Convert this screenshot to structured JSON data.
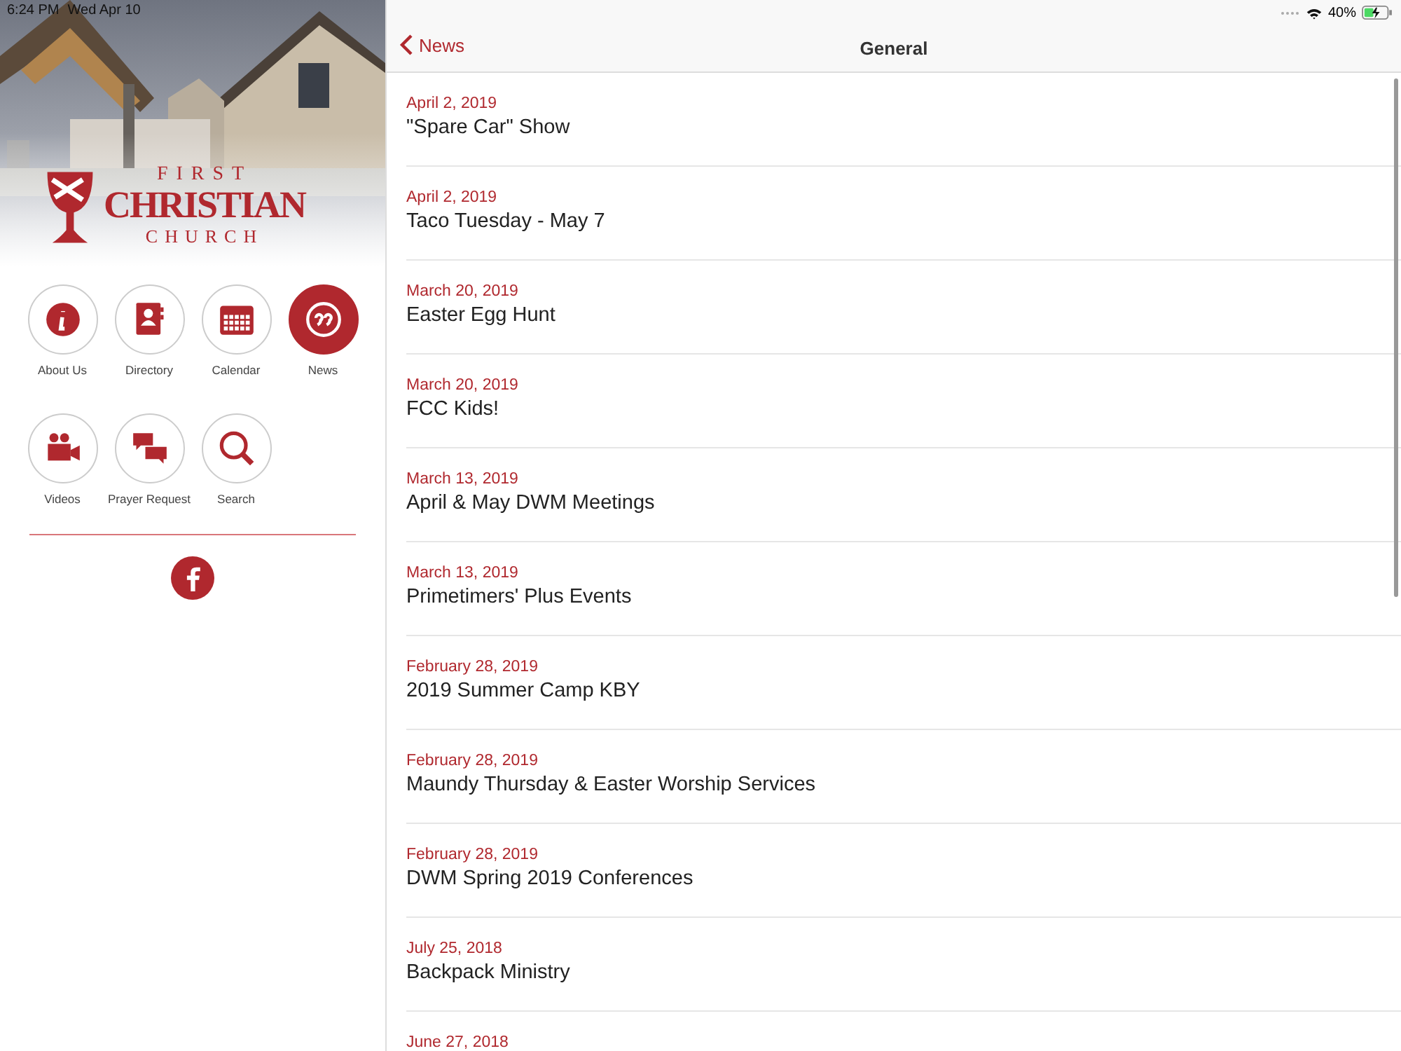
{
  "status_bar": {
    "time": "6:24 PM",
    "date": "Wed Apr 10",
    "battery": "40%"
  },
  "logo": {
    "line_1": "FIRST",
    "line_2": "CHRISTIAN",
    "line_3": "CHURCH"
  },
  "menu": [
    {
      "kind": "info",
      "label": "About Us",
      "selected": false
    },
    {
      "kind": "directory",
      "label": "Directory",
      "selected": false
    },
    {
      "kind": "calendar",
      "label": "Calendar",
      "selected": false
    },
    {
      "kind": "quote",
      "label": "News",
      "selected": true
    },
    {
      "kind": "video",
      "label": "Videos",
      "selected": false
    },
    {
      "kind": "chat",
      "label": "Prayer Request",
      "selected": false
    },
    {
      "kind": "search",
      "label": "Search",
      "selected": false
    }
  ],
  "nav": {
    "back": "News",
    "title": "General"
  },
  "news": [
    {
      "date": "April 2, 2019",
      "title": "\"Spare Car\" Show"
    },
    {
      "date": "April 2, 2019",
      "title": "Taco Tuesday - May 7"
    },
    {
      "date": "March 20, 2019",
      "title": "Easter Egg Hunt"
    },
    {
      "date": "March 20, 2019",
      "title": "FCC Kids!"
    },
    {
      "date": "March 13, 2019",
      "title": "April & May DWM Meetings"
    },
    {
      "date": "March 13, 2019",
      "title": "Primetimers' Plus Events"
    },
    {
      "date": "February 28, 2019",
      "title": "2019 Summer Camp KBY"
    },
    {
      "date": "February 28, 2019",
      "title": "Maundy Thursday & Easter Worship Services"
    },
    {
      "date": "February 28, 2019",
      "title": "DWM Spring 2019 Conferences"
    },
    {
      "date": "July 25, 2018",
      "title": "Backpack Ministry"
    },
    {
      "date": "June 27, 2018"
    }
  ]
}
